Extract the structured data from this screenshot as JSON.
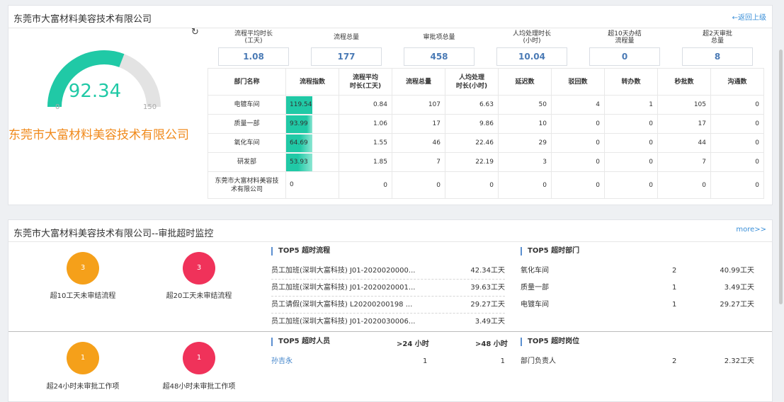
{
  "panel1": {
    "title": "东莞市大富材料美容技术有限公司",
    "back_link": "←返回上级",
    "refresh_icon": "↻",
    "company_name": "东莞市大富材料美容技术有限公司",
    "gauge": {
      "value": "92.34",
      "fraction": 0.6156,
      "min": "0",
      "max": "150",
      "color": "#20c9a6"
    },
    "stats": [
      {
        "label": "流程平均时长\n(工天)",
        "value": "1.08"
      },
      {
        "label": "流程总量",
        "value": "177"
      },
      {
        "label": "审批项总量",
        "value": "458"
      },
      {
        "label": "人均处理时长\n(小时)",
        "value": "10.04"
      },
      {
        "label": "超10天办结\n流程量",
        "value": "0"
      },
      {
        "label": "超2天审批\n总量",
        "value": "8"
      }
    ],
    "table": {
      "headers": [
        "部门名称",
        "流程指数",
        "流程平均\n时长(工天)",
        "流程总量",
        "人均处理\n时长(小时)",
        "延迟数",
        "驳回数",
        "转办数",
        "秒批数",
        "沟通数"
      ],
      "rows": [
        {
          "dept": "电镀车间",
          "index": "119.54",
          "index_level": 1.0,
          "avg": "0.84",
          "total": "107",
          "per": "6.63",
          "delay": "50",
          "reject": "4",
          "transfer": "1",
          "instant": "105",
          "comm": "0"
        },
        {
          "dept": "质量一部",
          "index": "93.99",
          "index_level": 0.79,
          "avg": "1.06",
          "total": "17",
          "per": "9.86",
          "delay": "10",
          "reject": "0",
          "transfer": "0",
          "instant": "17",
          "comm": "0"
        },
        {
          "dept": "氧化车间",
          "index": "64.69",
          "index_level": 0.54,
          "avg": "1.55",
          "total": "46",
          "per": "22.46",
          "delay": "29",
          "reject": "0",
          "transfer": "0",
          "instant": "44",
          "comm": "0"
        },
        {
          "dept": "研发部",
          "index": "53.93",
          "index_level": 0.45,
          "avg": "1.85",
          "total": "7",
          "per": "22.19",
          "delay": "3",
          "reject": "0",
          "transfer": "0",
          "instant": "7",
          "comm": "0"
        },
        {
          "dept": "东莞市大富材料美容技术有限公司",
          "index": "0",
          "index_level": 0,
          "avg": "0",
          "total": "0",
          "per": "0",
          "delay": "0",
          "reject": "0",
          "transfer": "0",
          "instant": "0",
          "comm": "0"
        }
      ]
    }
  },
  "panel2": {
    "title": "东莞市大富材料美容技术有限公司--审批超时监控",
    "more_link": "more>>",
    "circles": [
      {
        "value": "3",
        "label": "超10工天未审结流程",
        "color": "#f5a01a"
      },
      {
        "value": "3",
        "label": "超20工天未审结流程",
        "color": "#f0325a"
      },
      {
        "value": "1",
        "label": "超24小时未审批工作项",
        "color": "#f5a01a"
      },
      {
        "value": "1",
        "label": "超48小时未审批工作项",
        "color": "#f0325a"
      }
    ],
    "top5_process": {
      "title": "TOP5 超时流程",
      "rows": [
        {
          "name": "员工加班(深圳大富科技) J01-2020020000...",
          "value": "42.34工天"
        },
        {
          "name": "员工加班(深圳大富科技) J01-2020020001...",
          "value": "39.63工天"
        },
        {
          "name": "员工请假(深圳大富科技) L20200200198 ...",
          "value": "29.27工天"
        },
        {
          "name": "员工加班(深圳大富科技) J01-2020030006...",
          "value": "3.49工天"
        }
      ]
    },
    "top5_dept": {
      "title": "TOP5 超时部门",
      "rows": [
        {
          "name": "氧化车间",
          "count": "2",
          "value": "40.99工天"
        },
        {
          "name": "质量一部",
          "count": "1",
          "value": "3.49工天"
        },
        {
          "name": "电镀车间",
          "count": "1",
          "value": "29.27工天"
        }
      ]
    },
    "top5_person": {
      "title": "TOP5 超时人员",
      "col1": ">24 小时",
      "col2": ">48 小时",
      "rows": [
        {
          "name": "孙吉永",
          "c1": "1",
          "c2": "1"
        }
      ]
    },
    "top5_post": {
      "title": "TOP5 超时岗位",
      "rows": [
        {
          "name": "部门负责人",
          "count": "2",
          "value": "2.32工天"
        }
      ]
    }
  }
}
